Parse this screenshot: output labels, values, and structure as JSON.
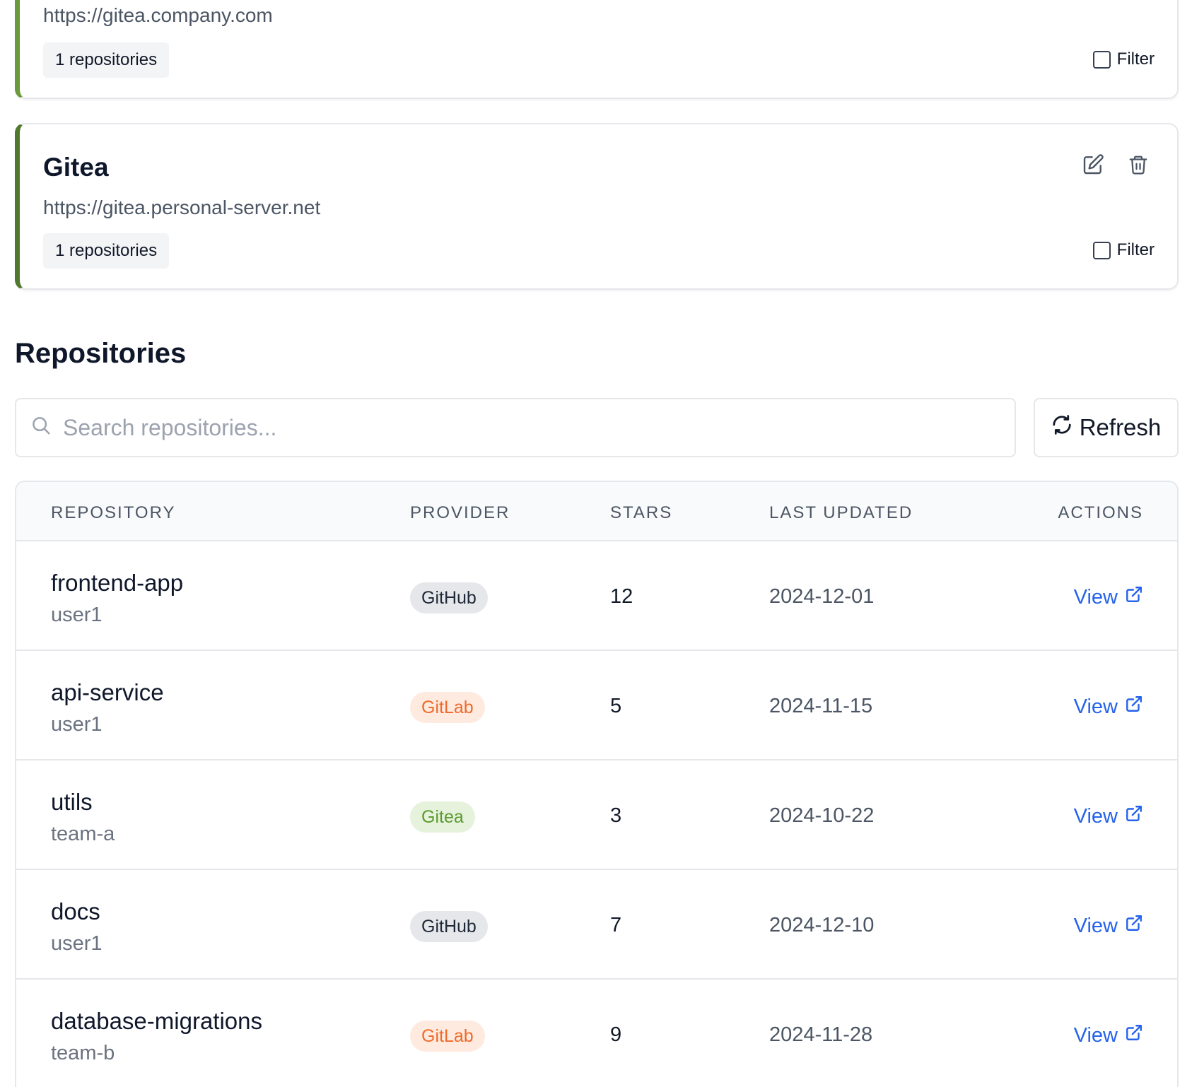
{
  "providers": [
    {
      "name": "",
      "url": "https://gitea.company.com",
      "repo_count": "1 repositories",
      "filter_label": "Filter",
      "accent": "#6a9a3c"
    },
    {
      "name": "Gitea",
      "url": "https://gitea.personal-server.net",
      "repo_count": "1 repositories",
      "filter_label": "Filter",
      "accent": "#4f7a2e",
      "icons": [
        "edit-icon",
        "trash-icon"
      ]
    }
  ],
  "repositories": {
    "title": "Repositories",
    "search_placeholder": "Search repositories...",
    "refresh_label": "Refresh",
    "columns": [
      "REPOSITORY",
      "PROVIDER",
      "STARS",
      "LAST UPDATED",
      "ACTIONS"
    ],
    "rows": [
      {
        "name": "frontend-app",
        "owner": "user1",
        "provider": "GitHub",
        "stars": "12",
        "updated": "2024-12-01",
        "action": "View"
      },
      {
        "name": "api-service",
        "owner": "user1",
        "provider": "GitLab",
        "stars": "5",
        "updated": "2024-11-15",
        "action": "View"
      },
      {
        "name": "utils",
        "owner": "team-a",
        "provider": "Gitea",
        "stars": "3",
        "updated": "2024-10-22",
        "action": "View"
      },
      {
        "name": "docs",
        "owner": "user1",
        "provider": "GitHub",
        "stars": "7",
        "updated": "2024-12-10",
        "action": "View"
      },
      {
        "name": "database-migrations",
        "owner": "team-b",
        "provider": "GitLab",
        "stars": "9",
        "updated": "2024-11-28",
        "action": "View"
      }
    ],
    "provider_colors": {
      "GitHub": {
        "bg": "#e5e7eb",
        "fg": "#1f2937"
      },
      "GitLab": {
        "bg": "#ffeadf",
        "fg": "#f06a2a"
      },
      "Gitea": {
        "bg": "#e6f2dc",
        "fg": "#5b9a2e"
      }
    },
    "link_color": "#2563eb"
  }
}
